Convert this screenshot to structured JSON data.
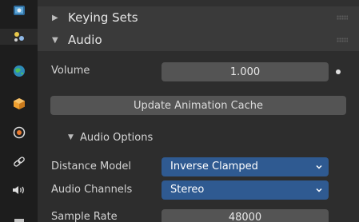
{
  "keying_sets": {
    "label": "Keying Sets"
  },
  "audio": {
    "label": "Audio",
    "volume": {
      "label": "Volume",
      "value": "1.000"
    },
    "update_cache_label": "Update Animation Cache",
    "options": {
      "label": "Audio Options",
      "distance_model": {
        "label": "Distance Model",
        "value": "Inverse Clamped"
      },
      "audio_channels": {
        "label": "Audio Channels",
        "value": "Stereo"
      },
      "sample_rate": {
        "label": "Sample Rate",
        "value": "48000"
      }
    }
  },
  "icons": {
    "tabs": [
      "render-icon",
      "output-icon",
      "scene-icon",
      "world-icon",
      "object-icon",
      "physics-icon",
      "constraints-icon",
      "audio-speaker-icon",
      "view-layer-icon"
    ]
  },
  "colors": {
    "dropdown_accent": "#2f5a91",
    "field_bg": "#545454",
    "panel_header_bg": "#3a3a3a",
    "tab_bar_bg": "#1d1d1d"
  }
}
